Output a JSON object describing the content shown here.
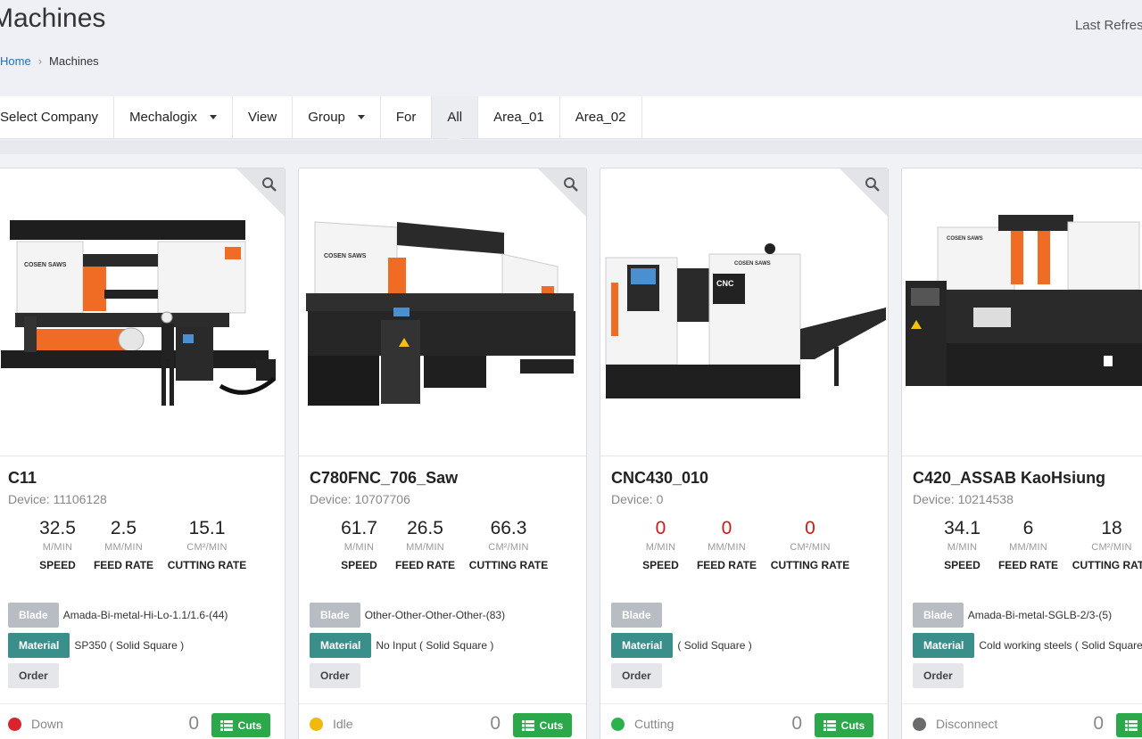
{
  "header": {
    "title": "Machines",
    "last_refresh": "Last Refresh",
    "breadcrumb": {
      "home": "Home",
      "separator": "›",
      "current": "Machines"
    }
  },
  "filters": {
    "select_company_label": "Select Company",
    "company_value": "Mechalogix",
    "view_label": "View",
    "group_value": "Group",
    "for_label": "For",
    "areas": [
      "All",
      "Area_01",
      "Area_02"
    ],
    "active_area": "All"
  },
  "labels": {
    "speed": "SPEED",
    "feed_rate": "FEED RATE",
    "cutting_rate": "CUTTING RATE",
    "speed_unit": "M/MIN",
    "feed_unit": "MM/MIN",
    "cutting_unit": "CM²/MIN",
    "blade": "Blade",
    "material": "Material",
    "order": "Order",
    "cuts": "Cuts"
  },
  "machines": [
    {
      "name": "C11",
      "device": "Device: 11106128",
      "speed": "32.5",
      "feed_rate": "2.5",
      "cutting_rate": "15.1",
      "blade": "Amada-Bi-metal-Hi-Lo-1.1/1.6-(44)",
      "material": "SP350 ( Solid Square )",
      "status": "Down",
      "status_color": "#d9232d",
      "cut_count": "0"
    },
    {
      "name": "C780FNC_706_Saw",
      "device": "Device: 10707706",
      "speed": "61.7",
      "feed_rate": "26.5",
      "cutting_rate": "66.3",
      "blade": "Other-Other-Other-Other-(83)",
      "material": "No Input ( Solid Square )",
      "status": "Idle",
      "status_color": "#f0b90b",
      "cut_count": "0"
    },
    {
      "name": "CNC430_010",
      "device": "Device: 0",
      "speed": "0",
      "feed_rate": "0",
      "cutting_rate": "0",
      "blade": "",
      "material": "( Solid Square )",
      "status": "Cutting",
      "status_color": "#2bb24c",
      "cut_count": "0"
    },
    {
      "name": "C420_ASSAB KaoHsiung",
      "device": "Device: 10214538",
      "speed": "34.1",
      "feed_rate": "6",
      "cutting_rate": "18",
      "blade": "Amada-Bi-metal-SGLB-2/3-(5)",
      "material": "Cold working steels ( Solid Square )",
      "status": "Disconnect",
      "status_color": "#6b6b6b",
      "cut_count": "0"
    }
  ],
  "colors": {
    "accent_link": "#2a6fb7",
    "zero_value": "#d01818",
    "cuts_button": "#2ba84a",
    "material_tag": "#3b8f8b",
    "saw_orange": "#f06b23"
  },
  "icons": {
    "zoom": "search-icon",
    "cuts": "list-icon",
    "dropdown": "caret-down-icon"
  }
}
